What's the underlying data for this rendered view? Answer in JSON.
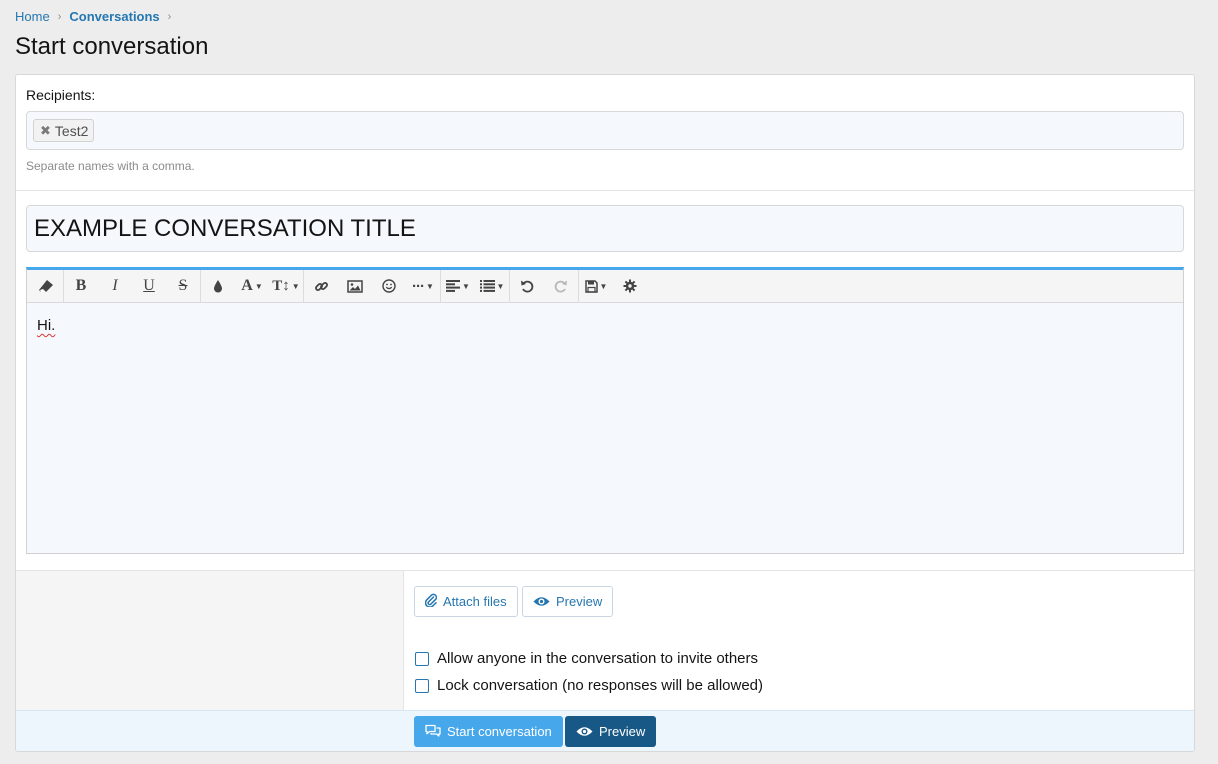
{
  "breadcrumb": {
    "home": "Home",
    "conversations": "Conversations",
    "separator": "›"
  },
  "page": {
    "title": "Start conversation"
  },
  "recipients": {
    "label": "Recipients:",
    "tokens": [
      "Test2"
    ],
    "hint": "Separate names with a comma."
  },
  "conversation": {
    "title_value": "EXAMPLE CONVERSATION TITLE",
    "message": "Hi."
  },
  "toolbar": {
    "icons": [
      "eraser-icon",
      "bold-icon",
      "italic-icon",
      "underline-icon",
      "strikethrough-icon",
      "text-color-icon",
      "font-family-icon",
      "font-size-icon",
      "link-icon",
      "image-icon",
      "smiley-icon",
      "more-options-icon",
      "align-icon",
      "list-icon",
      "undo-icon",
      "redo-icon",
      "drafts-icon",
      "settings-icon"
    ]
  },
  "actions": {
    "attach_files": "Attach files",
    "preview": "Preview",
    "start_conversation": "Start conversation",
    "preview_primary": "Preview"
  },
  "options": {
    "open_invite": "Allow anyone in the conversation to invite others",
    "lock": "Lock conversation (no responses will be allowed)",
    "open_invite_checked": false,
    "lock_checked": false
  },
  "colors": {
    "accent": "#2577b1",
    "primary_button": "#47a7eb",
    "secondary_button": "#185886",
    "editor_top_border": "#47a7eb"
  }
}
